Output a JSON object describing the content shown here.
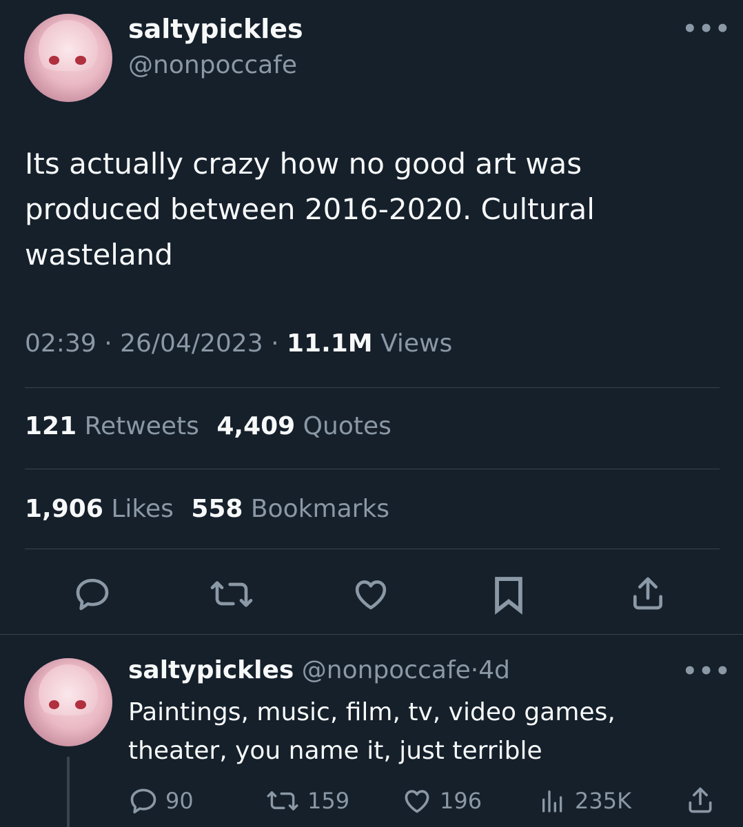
{
  "tweet": {
    "display_name": "saltypickles",
    "handle": "@nonpoccafe",
    "more_label": "•••",
    "text": "Its actually crazy how no good art was produced between 2016-2020. Cultural wasteland",
    "time": "02:39",
    "sep1": "·",
    "date": "26/04/2023",
    "sep2": "·",
    "views_count": "11.1M",
    "views_label": "Views",
    "retweets_count": "121",
    "retweets_label": "Retweets",
    "quotes_count": "4,409",
    "quotes_label": "Quotes",
    "likes_count": "1,906",
    "likes_label": "Likes",
    "bookmarks_count": "558",
    "bookmarks_label": "Bookmarks",
    "actions": [
      "reply-icon",
      "retweet-icon",
      "like-icon",
      "bookmark-icon",
      "share-icon"
    ]
  },
  "reply": {
    "display_name": "saltypickles",
    "handle": "@nonpoccafe",
    "sep": "·",
    "age": "4d",
    "more_label": "•••",
    "text": "Paintings, music, film, tv, video games, theater, you name it, just terrible",
    "replies": "90",
    "retweets": "159",
    "likes": "196",
    "views": "235K"
  },
  "colors": {
    "background": "#15202b",
    "text": "#f7f9f9",
    "secondary": "#8b98a5",
    "divider": "#38444d"
  }
}
